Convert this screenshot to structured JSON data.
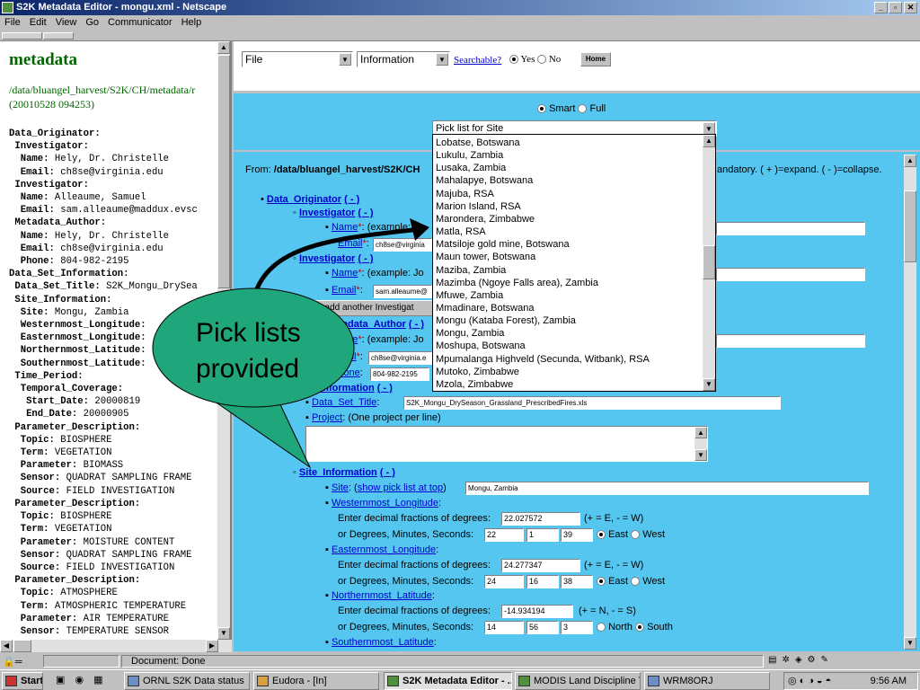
{
  "window": {
    "title": "S2K Metadata Editor - mongu.xml - Netscape"
  },
  "menu": [
    "File",
    "Edit",
    "View",
    "Go",
    "Communicator",
    "Help"
  ],
  "left": {
    "heading": "metadata",
    "path_line1": "/data/bluangel_harvest/S2K/CH/metadata/r",
    "path_line2": "(20010528 094253)",
    "tree": [
      {
        "k": "Data_Originator:",
        "v": "",
        "i": 0
      },
      {
        "k": "Investigator:",
        "v": "",
        "i": 1
      },
      {
        "k": "Name:",
        "v": " Hely, Dr. Christelle",
        "i": 2
      },
      {
        "k": "Email:",
        "v": " ch8se@virginia.edu",
        "i": 2
      },
      {
        "k": "Investigator:",
        "v": "",
        "i": 1
      },
      {
        "k": "Name:",
        "v": " Alleaume, Samuel",
        "i": 2
      },
      {
        "k": "Email:",
        "v": " sam.alleaume@maddux.evsc",
        "i": 2
      },
      {
        "k": "Metadata_Author:",
        "v": "",
        "i": 1
      },
      {
        "k": "Name:",
        "v": " Hely, Dr. Christelle",
        "i": 2
      },
      {
        "k": "Email:",
        "v": " ch8se@virginia.edu",
        "i": 2
      },
      {
        "k": "Phone:",
        "v": " 804-982-2195",
        "i": 2
      },
      {
        "k": "Data_Set_Information:",
        "v": "",
        "i": 0
      },
      {
        "k": "Data_Set_Title:",
        "v": " S2K_Mongu_DrySea",
        "i": 1
      },
      {
        "k": "Site_Information:",
        "v": "",
        "i": 1
      },
      {
        "k": "Site:",
        "v": " Mongu, Zambia",
        "i": 2
      },
      {
        "k": "Westernmost_Longitude:",
        "v": "",
        "i": 2
      },
      {
        "k": "Easternmost_Longitude:",
        "v": "",
        "i": 2
      },
      {
        "k": "Northernmost_Latitude:",
        "v": "",
        "i": 2
      },
      {
        "k": "Southernmost_Latitude:",
        "v": "",
        "i": 2
      },
      {
        "k": "Time_Period:",
        "v": "",
        "i": 1
      },
      {
        "k": "Temporal_Coverage:",
        "v": "",
        "i": 2
      },
      {
        "k": "Start_Date:",
        "v": " 20000819",
        "i": 3
      },
      {
        "k": "End_Date:",
        "v": " 20000905",
        "i": 3
      },
      {
        "k": "Parameter_Description:",
        "v": "",
        "i": 1
      },
      {
        "k": "Topic:",
        "v": " BIOSPHERE",
        "i": 2
      },
      {
        "k": "Term:",
        "v": " VEGETATION",
        "i": 2
      },
      {
        "k": "Parameter:",
        "v": " BIOMASS",
        "i": 2
      },
      {
        "k": "Sensor:",
        "v": " QUADRAT SAMPLING FRAME",
        "i": 2
      },
      {
        "k": "Source:",
        "v": " FIELD INVESTIGATION",
        "i": 2
      },
      {
        "k": "Parameter_Description:",
        "v": "",
        "i": 1
      },
      {
        "k": "Topic:",
        "v": " BIOSPHERE",
        "i": 2
      },
      {
        "k": "Term:",
        "v": " VEGETATION",
        "i": 2
      },
      {
        "k": "Parameter:",
        "v": " MOISTURE CONTENT",
        "i": 2
      },
      {
        "k": "Sensor:",
        "v": " QUADRAT SAMPLING FRAME",
        "i": 2
      },
      {
        "k": "Source:",
        "v": " FIELD INVESTIGATION",
        "i": 2
      },
      {
        "k": "Parameter_Description:",
        "v": "",
        "i": 1
      },
      {
        "k": "Topic:",
        "v": " ATMOSPHERE",
        "i": 2
      },
      {
        "k": "Term:",
        "v": " ATMOSPHERIC TEMPERATURE",
        "i": 2
      },
      {
        "k": "Parameter:",
        "v": " AIR TEMPERATURE",
        "i": 2
      },
      {
        "k": "Sensor:",
        "v": " TEMPERATURE SENSOR",
        "i": 2
      }
    ]
  },
  "top": {
    "file_select": "File",
    "info_select": "Information",
    "searchable_label": "Searchable?",
    "yes": "Yes",
    "no": "No",
    "home": "Home"
  },
  "mid": {
    "smart": "Smart",
    "full": "Full",
    "picklist_header": "Pick list for Site"
  },
  "picklist": [
    "Lobatse, Botswana",
    "Lukulu, Zambia",
    "Lusaka, Zambia",
    "Mahalapye, Botswana",
    "Majuba, RSA",
    "Marion Island, RSA",
    "Marondera, Zimbabwe",
    "Matla, RSA",
    "Matsiloje gold mine, Botswana",
    "Maun tower, Botswana",
    "Maziba, Zambia",
    "Mazimba (Ngoye Falls area), Zambia",
    "Mfuwe, Zambia",
    "Mmadinare, Botswana",
    "Mongu (Kataba Forest), Zambia",
    "Mongu, Zambia",
    "Moshupa, Botswana",
    "Mpumalanga Highveld (Secunda, Witbank), RSA",
    "Mutoko, Zimbabwe",
    "Mzola, Zimbabwe"
  ],
  "form": {
    "from_label": "From: ",
    "from_path": "/data/bluangel_harvest/S2K/CH",
    "legend_tail": "andatory. ( + )=expand. ( - )=collapse.",
    "data_originator": "Data_Originator",
    "collapse": "( - )",
    "investigator": "Investigator",
    "name": "Name",
    "email": "Email",
    "phone": "Phone",
    "name_example": ": (example: Jo",
    "email1": "ch8se@virginia",
    "email2": "sam.alleaume@",
    "add_investigator": "add another Investigat",
    "metadata_author": "Metadata_Author",
    "email3": "ch8se@virginia.e",
    "phone_val": "804-982-2195",
    "set_information": "Set_Information",
    "data_set_title": "Data_Set_Title",
    "title_val": "S2K_Mongu_DrySeason_Grassland_PrescribedFires.xls",
    "project": "Project",
    "project_note": ": (One project per line)",
    "site_information": "Site_Information",
    "site": "Site",
    "show_pick": "show pick list at top",
    "site_val": "Mongu, Zambia",
    "west": "Westernmost_Longitude",
    "east_lbl": "Easternmost_Longitude",
    "north": "Northernmost_Latitude",
    "south": "Southernmost_Latitude",
    "dec_prompt": "Enter decimal fractions of degrees:",
    "dms_prompt": "or Degrees, Minutes, Seconds:",
    "ew_hint": "(+ = E, - = W)",
    "ns_hint": "(+ = N, - = S)",
    "west_dec": "22.027572",
    "west_d": "22",
    "west_m": "1",
    "west_s": "39",
    "east_dec": "24.277347",
    "east_d": "24",
    "east_m": "16",
    "east_s": "38",
    "north_dec": "-14.934194",
    "north_d": "14",
    "north_m": "56",
    "north_s": "3",
    "r_east": "East",
    "r_west": "West",
    "r_north": "North",
    "r_south": "South"
  },
  "callout": {
    "text_line1": "Pick lists",
    "text_line2": "provided",
    "fill": "#1fa67a"
  },
  "status": {
    "text": "Document: Done"
  },
  "taskbar": {
    "start": "Start",
    "tasks": [
      "ORNL S2K Data status",
      "Eudora - [In]",
      "S2K Metadata Editor - ...",
      "MODIS Land Discipline Te...",
      "WRM8ORJ"
    ],
    "clock": "9:56 AM"
  }
}
